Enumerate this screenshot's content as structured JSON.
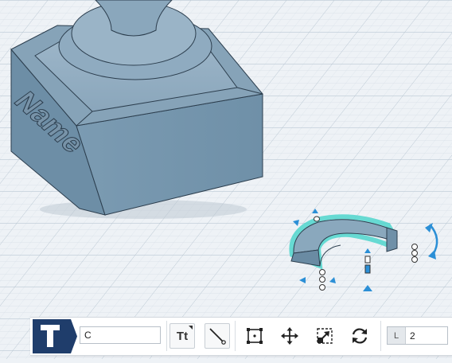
{
  "toolbar": {
    "text_value": "C",
    "text_style_label": "Tt",
    "length_label": "L",
    "length_value": "2"
  },
  "model": {
    "extruded_text": "Name"
  },
  "colors": {
    "grid_bg": "#eef2f6",
    "grid_line": "#c6d2dc",
    "model_blue": "#7f9fb6",
    "selection_cyan": "#4fd6cc",
    "handle_blue": "#2b8fd6",
    "logo_navy": "#1f3d6b"
  },
  "icons": {
    "logo": "letter-t-logo-icon",
    "line": "line-tool-icon",
    "bounding_box": "bounding-box-icon",
    "move": "move-icon",
    "scale": "scale-icon",
    "rotate": "rotate-icon"
  }
}
